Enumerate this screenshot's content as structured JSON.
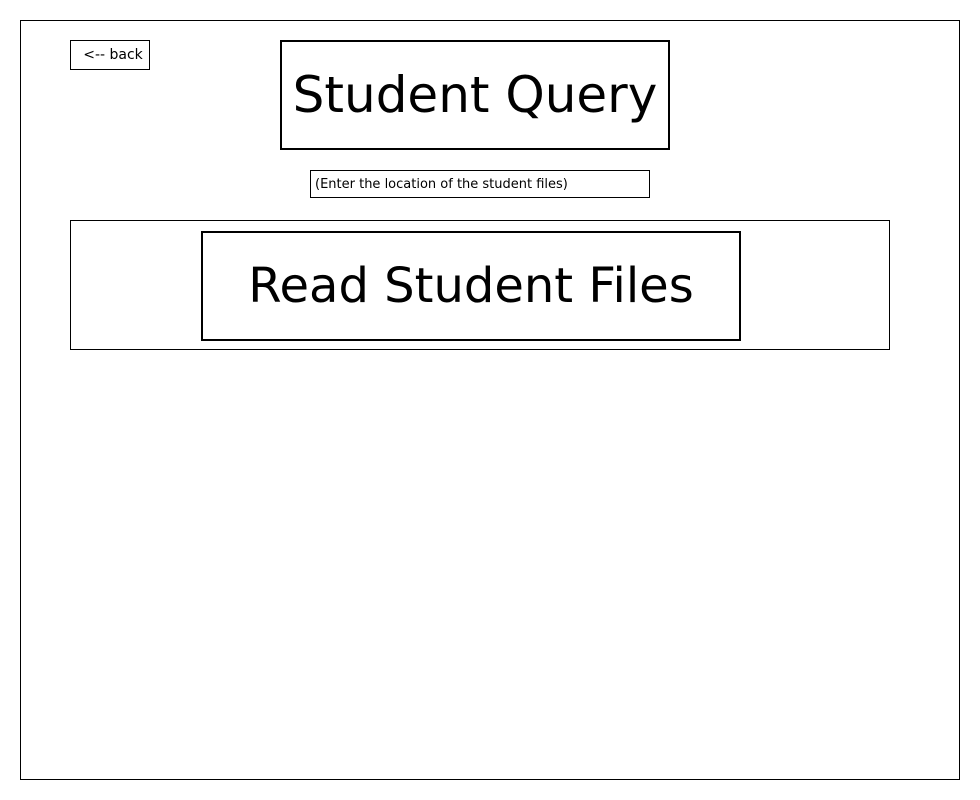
{
  "header": {
    "back_label": "<-- back",
    "title": "Student Query"
  },
  "form": {
    "location_placeholder": "(Enter the location of the student files)",
    "location_value": ""
  },
  "actions": {
    "read_files_label": "Read Student Files"
  },
  "colors": {
    "border": "#000000",
    "background": "#ffffff",
    "text": "#000000"
  }
}
